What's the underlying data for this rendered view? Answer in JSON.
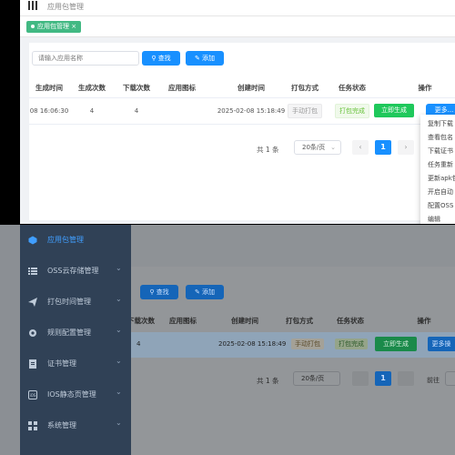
{
  "header": {
    "breadcrumb": "应用包管理"
  },
  "tags": [
    {
      "label": "应用包管理"
    }
  ],
  "toolbar": {
    "search_placeholder": "请输入应用名称",
    "search_button": "查找",
    "add_button": "添加"
  },
  "table": {
    "columns": [
      "生成时间",
      "生成次数",
      "下载次数",
      "应用图标",
      "创建时间",
      "打包方式",
      "任务状态",
      "操作"
    ],
    "rows": [
      {
        "gen_time": "08 16:06:30",
        "gen_count": "4",
        "download_count": "4",
        "icon": "",
        "created": "2025-02-08 15:18:49",
        "pack_mode": "手动打包",
        "status": "打包完成",
        "generate_button": "立即生成",
        "more_button": "更多..."
      }
    ]
  },
  "pagination": {
    "total_label": "共 1 条",
    "page_size": "20条/页",
    "prev": "‹",
    "current_page": "1",
    "next": "›"
  },
  "more_menu": [
    "复制下载",
    "查看包名",
    "下载证书",
    "任务重新",
    "更新apk包",
    "开启自动",
    "配置OSS",
    "编辑"
  ],
  "sidebar": {
    "items": [
      {
        "label": "应用包管理",
        "icon": "package-icon",
        "active": true
      },
      {
        "label": "OSS云存储管理",
        "icon": "list-icon"
      },
      {
        "label": "打包时间管理",
        "icon": "send-icon"
      },
      {
        "label": "规则配置管理",
        "icon": "gear-icon"
      },
      {
        "label": "证书管理",
        "icon": "certificate-icon"
      },
      {
        "label": "IOS静态页管理",
        "icon": "ios-icon"
      },
      {
        "label": "系统管理",
        "icon": "grid-icon"
      }
    ]
  },
  "dim": {
    "search_button": "查找",
    "add_button": "添加",
    "columns": [
      "下载次数",
      "应用图标",
      "创建时间",
      "打包方式",
      "任务状态",
      "操作"
    ],
    "row": {
      "download_count": "4",
      "created": "2025-02-08 15:18:49",
      "pack_mode": "手动打包",
      "status": "打包完成",
      "generate_button": "立即生成",
      "more_button": "更多操"
    },
    "total_label": "共 1 条",
    "page_size": "20条/页",
    "current_page": "1",
    "goto_label": "前往"
  },
  "colors": {
    "primary": "#1890ff",
    "success": "#1fc85b",
    "sidebar_bg": "#304156",
    "tag_bg": "#42b983",
    "active_text": "#409eff"
  }
}
